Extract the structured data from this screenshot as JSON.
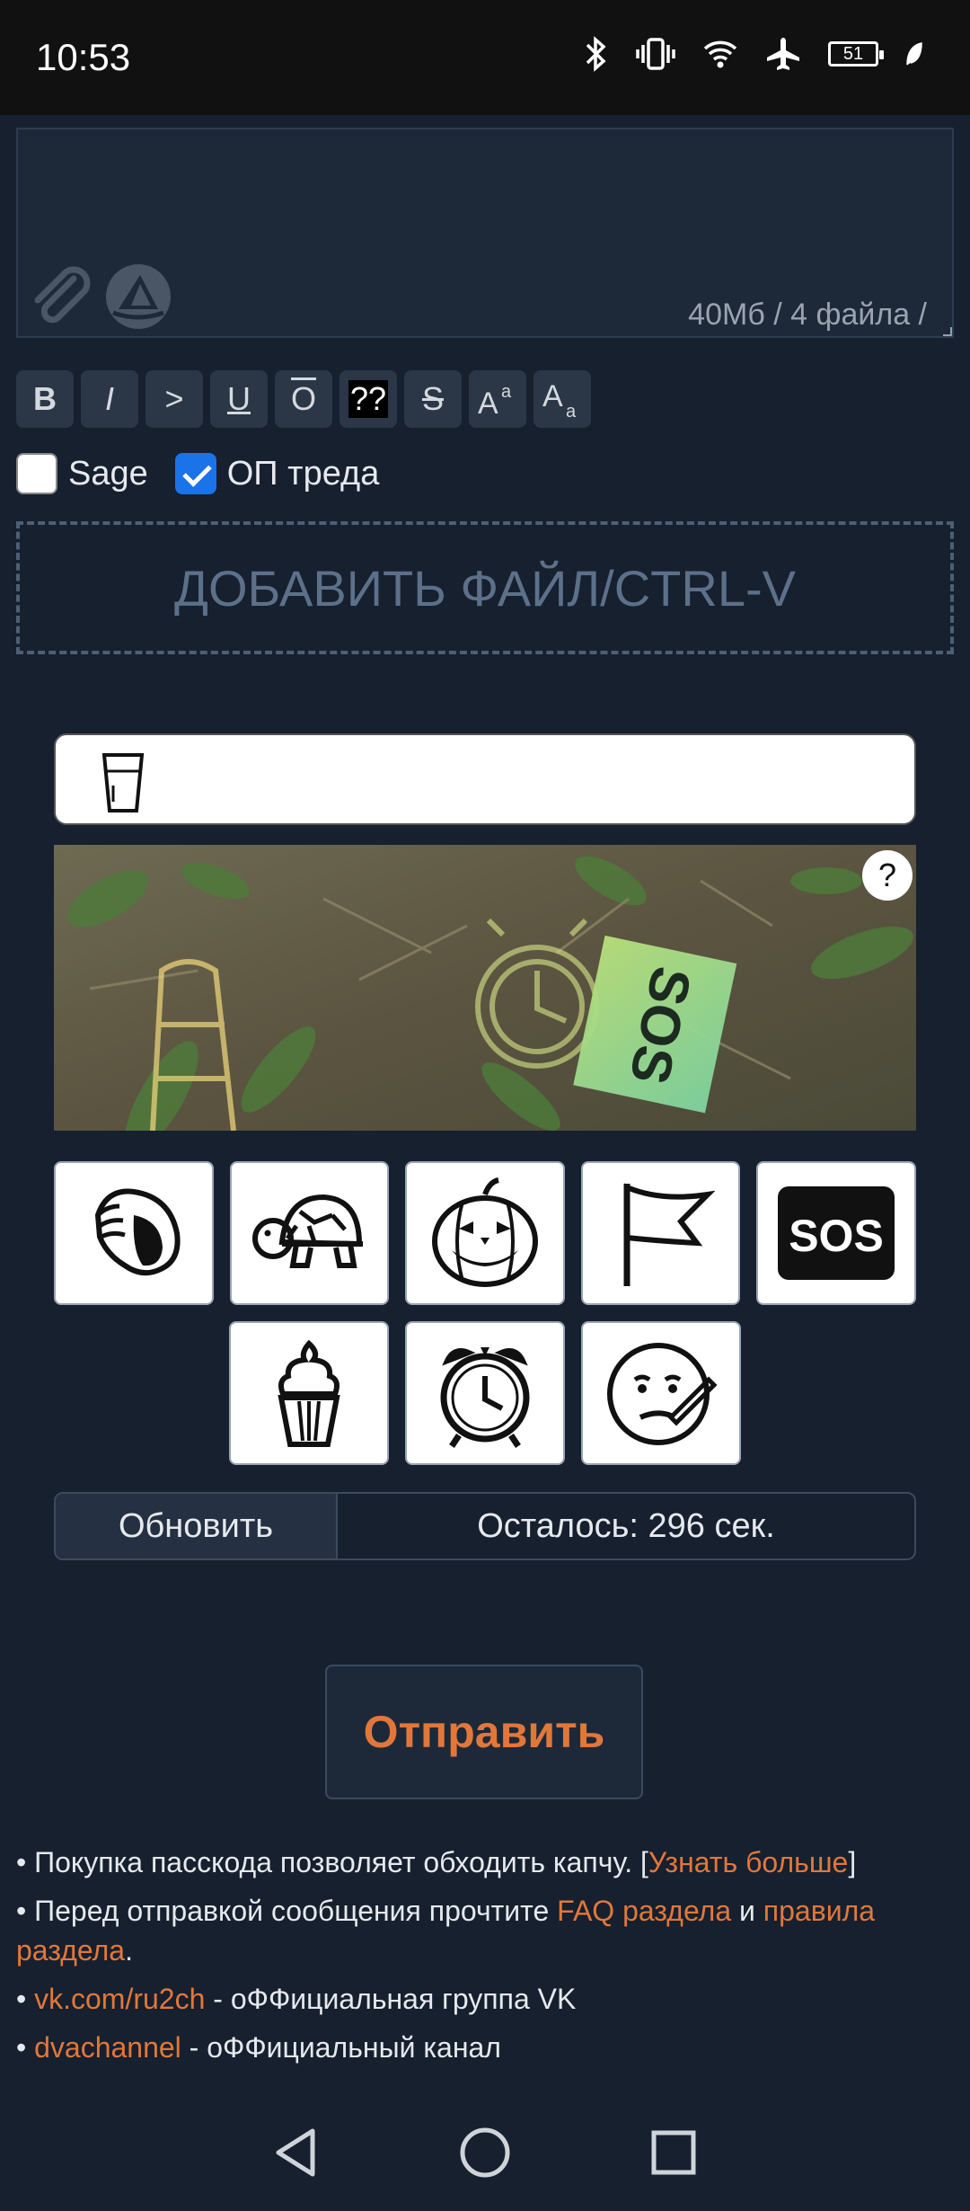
{
  "status_bar": {
    "time": "10:53",
    "battery": "51",
    "icons": [
      "bluetooth-icon",
      "vibrate-icon",
      "wifi-icon",
      "airplane-icon",
      "battery-icon",
      "leaf-icon"
    ]
  },
  "post_form": {
    "file_limit": "40Мб / 4 файла /",
    "toolbar": {
      "bold": "B",
      "italic": "I",
      "quote": ">",
      "underline": "U",
      "overline": "O",
      "spoiler": "??",
      "strike": "S"
    },
    "sage_label": "Sage",
    "sage_checked": false,
    "op_label": "ОП треда",
    "op_checked": true,
    "dropzone_label": "ДОБАВИТЬ ФАЙЛ/CTRL-V"
  },
  "captcha": {
    "help": "?",
    "selected_icon": "glass-icon",
    "choices": [
      "shell-icon",
      "turtle-icon",
      "pumpkin-icon",
      "flag-icon",
      "sos-icon",
      "ice-cream-icon",
      "alarm-clock-icon",
      "sick-face-icon"
    ],
    "sos_text": "SOS",
    "refresh_label": "Обновить",
    "timer_text": "Осталось: 296 сек."
  },
  "submit_label": "Отправить",
  "notes": {
    "n1_text": "• Покупка пасскода позволяет обходить капчу. [",
    "n1_link": "Узнать больше",
    "n1_end": "]",
    "n2_text": "• Перед отправкой сообщения прочтите ",
    "n2_link1": "FAQ раздела",
    "n2_mid": " и ",
    "n2_link2": "правила раздела",
    "n2_end": ".",
    "n3_link": "vk.com/ru2ch",
    "n3_text": " - оФФициальная группа VK",
    "n4_link": "dvachannel",
    "n4_text": " - оФФициальный канал"
  },
  "colors": {
    "background": "#16202e",
    "accent": "#e2773a",
    "checkbox_on": "#1a73e8"
  }
}
